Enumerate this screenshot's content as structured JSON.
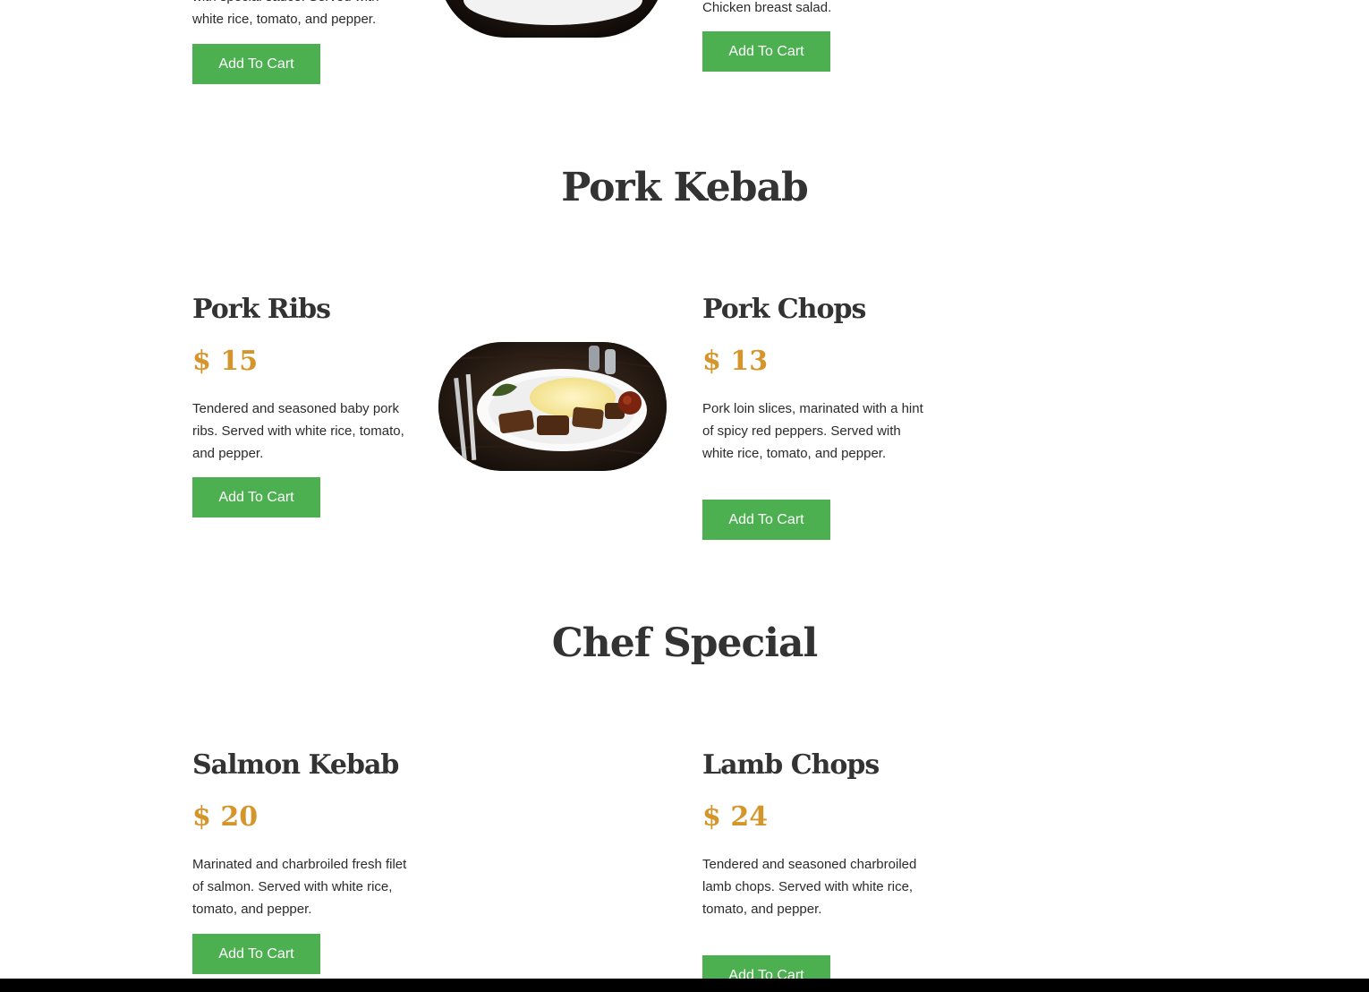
{
  "top_partial": {
    "left_desc": "with special sauce. Served with\nwhite rice, tomato, and pepper.",
    "right_desc": "Chicken breast salad.",
    "left_button": "Add To Cart",
    "right_button": "Add To Cart"
  },
  "sections": [
    {
      "title": "Pork Kebab",
      "items": [
        {
          "name": "Pork Ribs",
          "price": "$ 15",
          "description": "Tendered and seasoned baby pork ribs. Served with white rice, tomato, and pepper.",
          "button": "Add To Cart"
        },
        {
          "name": "Pork Chops",
          "price": "$ 13",
          "description": "Pork loin slices, marinated with a hint of spicy red peppers. Served with white rice, tomato, and pepper.",
          "button": "Add To Cart"
        }
      ]
    },
    {
      "title": "Chef Special",
      "items": [
        {
          "name": "Salmon Kebab",
          "price": "$ 20",
          "description": "Marinated and charbroiled fresh filet of salmon. Served with white rice, tomato, and pepper.",
          "button": "Add To Cart"
        },
        {
          "name": "Lamb Chops",
          "price": "$ 24",
          "description": "Tendered and seasoned charbroiled lamb chops. Served with white rice, tomato, and pepper.",
          "button": "Add To Cart"
        }
      ]
    }
  ],
  "colors": {
    "accent_button": "#4caf50",
    "price": "#d4952a",
    "heading": "#333333"
  }
}
